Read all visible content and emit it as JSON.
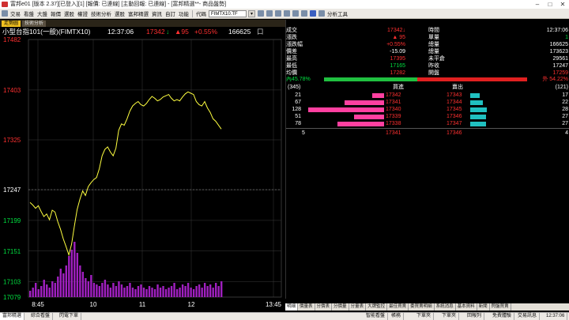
{
  "window": {
    "title": "富邦e01 [版本 2.37][已登入][1] [報價: 已連線] [主動回報: 已連線] - [富邦精選**- 商品盤勢]"
  },
  "toolbar": {
    "menus": [
      "交易",
      "看盤",
      "大盤",
      "報價",
      "選股",
      "權證",
      "技術分析",
      "選股",
      "富邦精選",
      "資訊",
      "自訂",
      "功能"
    ],
    "code_label": "代碼",
    "code_value": "FIMTX10.TF",
    "analysis_label": "分析工具"
  },
  "tabs": [
    {
      "label": "走勢圖",
      "active": true
    },
    {
      "label": "技術分析",
      "active": false
    }
  ],
  "chart_header": {
    "title": "小型台指101(一般)(FIMTX10)",
    "time": "12:37:06",
    "price": "17342",
    "arrow": "↓",
    "change": "▲95",
    "pct": "+0.55%",
    "volume": "166625",
    "box": "口"
  },
  "chart_data": {
    "type": "line",
    "y_ticks": [
      "17482",
      "17403",
      "17325",
      "17247",
      "17199",
      "17151",
      "17103",
      "17079"
    ],
    "y_tick_colors": [
      "red",
      "red",
      "red",
      "white",
      "green",
      "green",
      "green",
      "green"
    ],
    "x_ticks": [
      "8:45",
      "10",
      "11",
      "12",
      "13:45"
    ],
    "ylim": [
      17079,
      17482
    ],
    "reference_price": 17247,
    "price_series": [
      17227,
      17223,
      17218,
      17222,
      17213,
      17205,
      17209,
      17200,
      17215,
      17212,
      17197,
      17185,
      17170,
      17158,
      17145,
      17162,
      17190,
      17216,
      17232,
      17245,
      17238,
      17252,
      17258,
      17263,
      17266,
      17280,
      17300,
      17310,
      17314,
      17306,
      17300,
      17312,
      17340,
      17350,
      17348,
      17358,
      17370,
      17378,
      17382,
      17385,
      17380,
      17378,
      17382,
      17388,
      17393,
      17390,
      17386,
      17388,
      17392,
      17394,
      17396,
      17390,
      17386,
      17388,
      17386,
      17392,
      17397,
      17400,
      17398,
      17396,
      17385,
      17380,
      17378,
      17385,
      17375,
      17368,
      17358,
      17354,
      17348,
      17342
    ],
    "volume_series": [
      4,
      6,
      9,
      5,
      7,
      11,
      8,
      6,
      10,
      9,
      13,
      18,
      15,
      20,
      26,
      30,
      35,
      28,
      20,
      16,
      12,
      10,
      14,
      9,
      8,
      7,
      9,
      11,
      8,
      6,
      9,
      7,
      10,
      8,
      6,
      7,
      9,
      6,
      5,
      7,
      8,
      6,
      5,
      7,
      6,
      5,
      8,
      6,
      7,
      5,
      6,
      7,
      9,
      5,
      6,
      8,
      7,
      9,
      6,
      5,
      7,
      8,
      6,
      9,
      7,
      8,
      6,
      9,
      7,
      10
    ]
  },
  "quote": {
    "rows": [
      {
        "l": "成交",
        "lv": "17342↓",
        "lc": "red",
        "r": "時間",
        "rv": "12:37:06",
        "rc": "white"
      },
      {
        "l": "漲跌",
        "lv": "▲ 95",
        "lc": "red",
        "r": "單量",
        "rv": "1",
        "rc": "green"
      },
      {
        "l": "漲跌幅",
        "lv": "+0.55%",
        "lc": "red",
        "r": "總量",
        "rv": "166625",
        "rc": "white"
      },
      {
        "l": "價差",
        "lv": "-15.09",
        "lc": "white",
        "r": "總量",
        "rv": "173623",
        "rc": "white"
      },
      {
        "l": "最高",
        "lv": "17395",
        "lc": "red",
        "r": "未平倉",
        "rv": "29561",
        "rc": "white"
      },
      {
        "l": "最低",
        "lv": "17165",
        "lc": "green",
        "r": "昨收",
        "rv": "17247",
        "rc": "white"
      },
      {
        "l": "均價",
        "lv": "17282",
        "lc": "red",
        "r": "開盤",
        "rv": "17259",
        "rc": "red"
      }
    ],
    "inner_label": "內",
    "inner_pct": "45.78%",
    "outer_label": "外",
    "outer_pct": "54.22%",
    "inner_ratio": 0.4578,
    "book_header": {
      "bid_total": "(345)",
      "bid_label": "買進",
      "ask_label": "賣出",
      "ask_total": "(121)"
    },
    "book": [
      {
        "bid_qty": "21",
        "bid_price": "17342",
        "ask_price": "17343",
        "ask_qty": "17",
        "bid_ratio": 0.16,
        "ask_ratio": 0.13
      },
      {
        "bid_qty": "67",
        "bid_price": "17341",
        "ask_price": "17344",
        "ask_qty": "22",
        "bid_ratio": 0.52,
        "ask_ratio": 0.17
      },
      {
        "bid_qty": "128",
        "bid_price": "17340",
        "ask_price": "17345",
        "ask_qty": "28",
        "bid_ratio": 1.0,
        "ask_ratio": 0.22
      },
      {
        "bid_qty": "51",
        "bid_price": "17339",
        "ask_price": "17346",
        "ask_qty": "27",
        "bid_ratio": 0.4,
        "ask_ratio": 0.21
      },
      {
        "bid_qty": "78",
        "bid_price": "17338",
        "ask_price": "17347",
        "ask_qty": "27",
        "bid_ratio": 0.61,
        "ask_ratio": 0.21
      }
    ],
    "summary": {
      "left": "5",
      "bid": "17341",
      "ask": "17346",
      "right": "4"
    }
  },
  "bottom_tabs": [
    "明細",
    "價量表",
    "分價表",
    "分價量",
    "分量表",
    "大牌監控",
    "最佳買賣",
    "委買賣明細",
    "系統消息",
    "基本資料",
    "新聞",
    "閃盤買賣"
  ],
  "bottom_active": "明細",
  "statusbar": {
    "items": [
      "富邦精選",
      "綜合看盤",
      "閃電下單"
    ],
    "right_items": [
      "智能看盤",
      "帳務",
      "下單夾",
      "下單夾",
      "回報列",
      "免費體驗",
      "交易訊息"
    ],
    "clock": "12:37:06"
  }
}
